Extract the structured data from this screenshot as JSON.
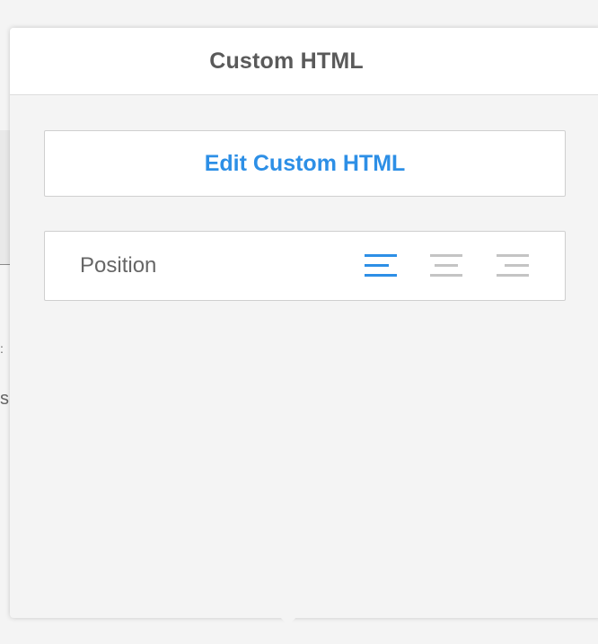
{
  "panel": {
    "title": "Custom HTML"
  },
  "edit_button": {
    "label": "Edit Custom HTML"
  },
  "position": {
    "label": "Position",
    "selected": "left",
    "options": [
      "align-left",
      "align-center",
      "align-right"
    ]
  },
  "background_fragments": {
    "line1": ":",
    "line2": "s"
  },
  "colors": {
    "accent": "#2d8fe6",
    "inactive_icon": "#c4c4c4",
    "title_text": "#5a5a5a",
    "label_text": "#666666"
  }
}
